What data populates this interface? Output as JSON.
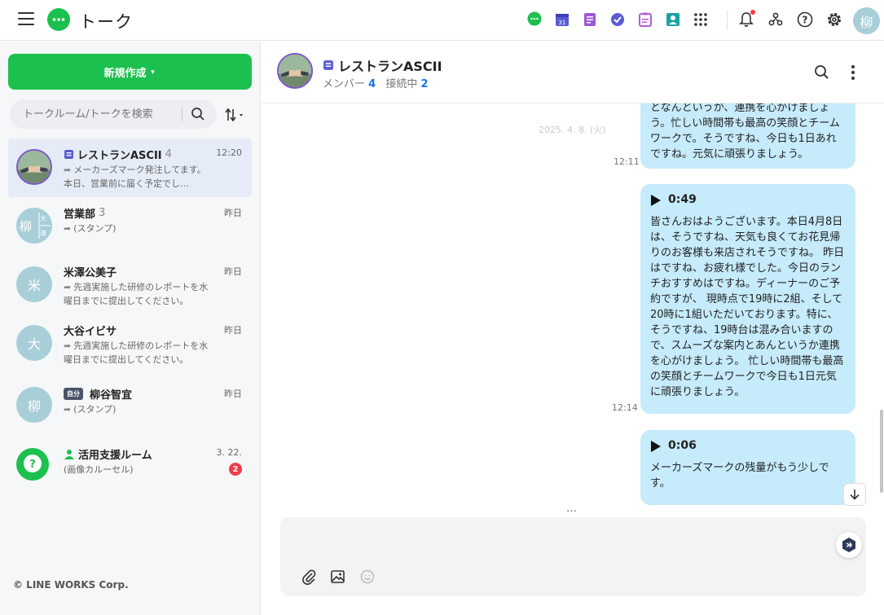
{
  "app": {
    "title": "トーク"
  },
  "sidebar": {
    "new_button": "新規作成",
    "search_placeholder": "トークルーム/トークを検索",
    "copyright": "© LINE WORKS Corp.",
    "chats": [
      {
        "name": "レストランASCII",
        "count": "4",
        "time": "12:20",
        "preview": "メーカーズマーク発注してます。本日、営業前に届く予定でし…",
        "icon": "room-icon"
      },
      {
        "name": "営業部",
        "count": "3",
        "time": "昨日",
        "preview": "(スタンプ)",
        "avatar_text": "柳",
        "avatar_sub1": "大",
        "avatar_sub2": "清"
      },
      {
        "name": "米澤公美子",
        "count": "",
        "time": "昨日",
        "preview": "先週実施した研修のレポートを水曜日までに提出してください。",
        "avatar_text": "米"
      },
      {
        "name": "大谷イビサ",
        "count": "",
        "time": "昨日",
        "preview": "先週実施した研修のレポートを水曜日までに提出してください。",
        "avatar_text": "大"
      },
      {
        "name": "柳谷智宜",
        "badge": "自分",
        "count": "",
        "time": "昨日",
        "preview": "(スタンプ)",
        "avatar_text": "柳"
      },
      {
        "name": "活用支援ルーム",
        "count": "",
        "time": "3. 22.",
        "preview": "(画像カルーセル)",
        "unread": "2"
      }
    ]
  },
  "header": {
    "user_avatar": "柳"
  },
  "room": {
    "title": "レストランASCII",
    "members_label": "メンバー",
    "members_count": "4",
    "online_label": "接続中",
    "online_count": "2"
  },
  "messages": {
    "date": "2025. 4. 8. (火)",
    "m1": {
      "text": "となんというか、連携を心がけましょう。忙しい時間帯も最高の笑顔とチームワークで。そうですね、今日も1日あれですね。元気に頑張りましょう。",
      "time": "12:11"
    },
    "m2": {
      "duration": "0:49",
      "text": "皆さんおはようございます。本日4月8日は、そうですね、天気も良くてお花見帰りのお客様も来店されそうですね。 昨日はですね、お疲れ様でした。今日のランチおすすめはですね。ディーナーのご予約ですが、 現時点で19時に2組、そして20時に1組いただいております。特に、そうですね、19時台は混み合いますので、スムーズな案内とあんというか連携を心がけましょう。 忙しい時間帯も最高の笑顔とチームワークで今日も1日元気に頑張りましょう。",
      "time": "12:14"
    },
    "m3": {
      "duration": "0:06",
      "text": "メーカーズマークの残量がもう少しです。"
    }
  },
  "composer": {
    "ellipsis": "…"
  }
}
